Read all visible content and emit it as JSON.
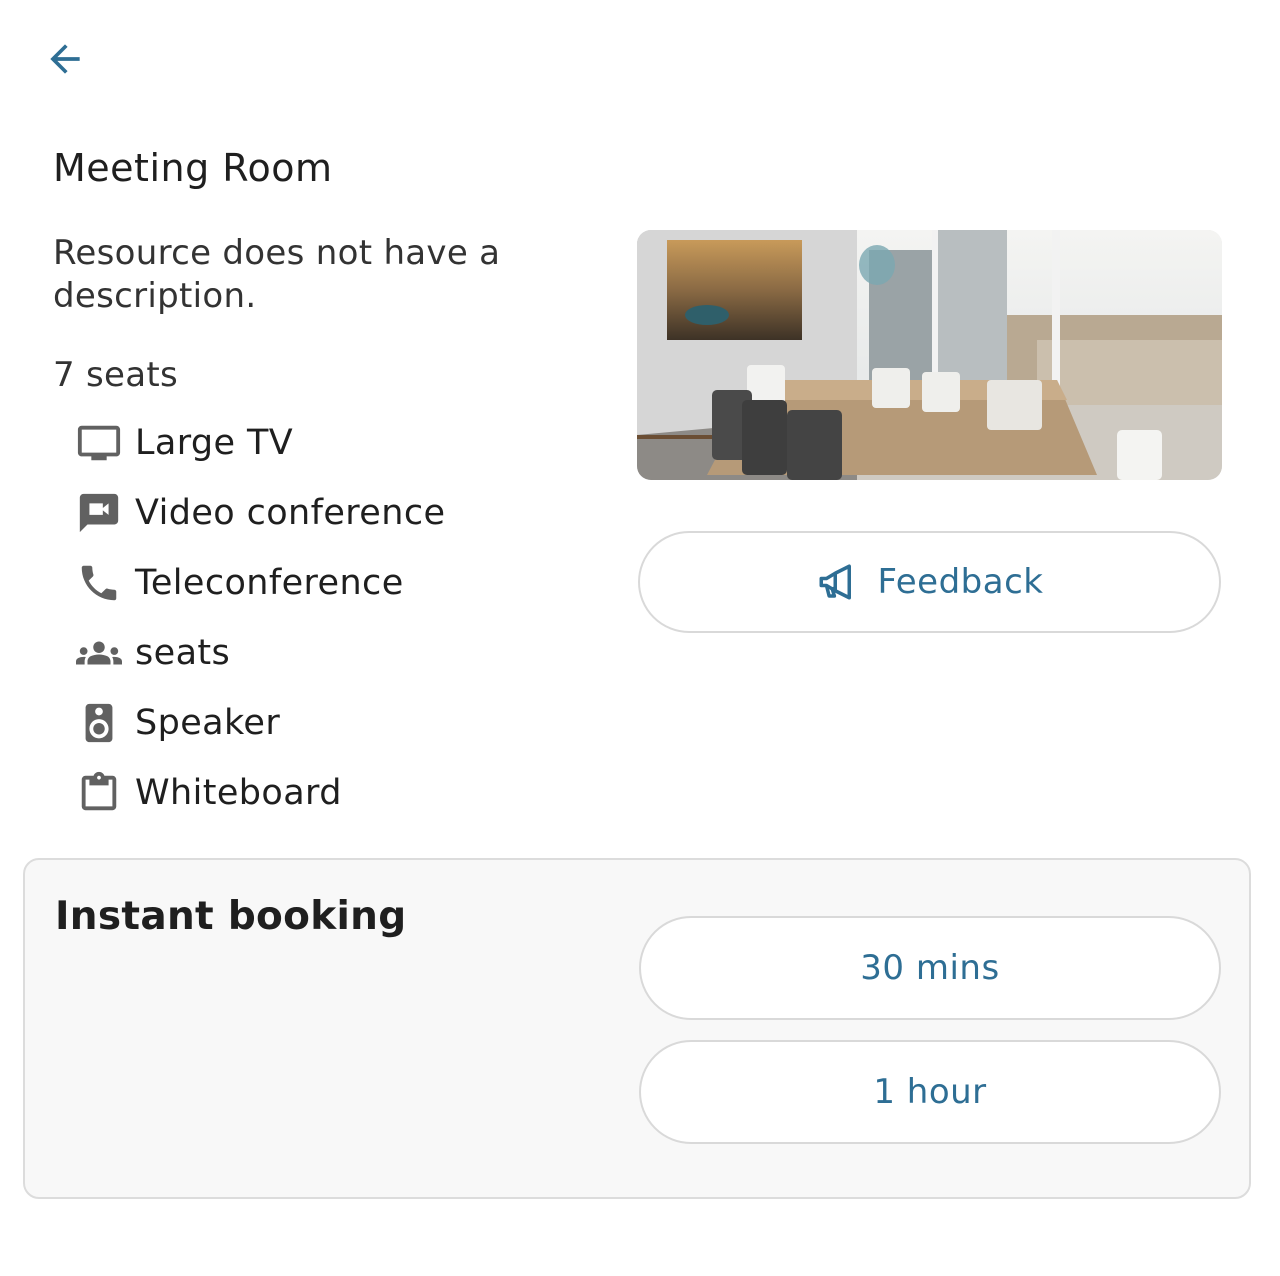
{
  "nav": {
    "back_icon": "arrow-left-icon"
  },
  "resource": {
    "title": "Meeting Room",
    "description": "Resource does not have a description.",
    "capacity": "7 seats",
    "features": [
      {
        "icon": "tv-icon",
        "label": "Large TV"
      },
      {
        "icon": "video-icon",
        "label": "Video conference"
      },
      {
        "icon": "phone-icon",
        "label": "Teleconference"
      },
      {
        "icon": "people-icon",
        "label": "seats"
      },
      {
        "icon": "speaker-icon",
        "label": "Speaker"
      },
      {
        "icon": "clipboard-icon",
        "label": "Whiteboard"
      }
    ]
  },
  "feedback": {
    "icon": "megaphone-icon",
    "label": "Feedback"
  },
  "booking": {
    "heading": "Instant booking",
    "options": [
      "30 mins",
      "1 hour"
    ]
  },
  "colors": {
    "accent": "#2e6e94",
    "icon_grey": "#616161",
    "panel_bg": "#f8f8f8"
  }
}
